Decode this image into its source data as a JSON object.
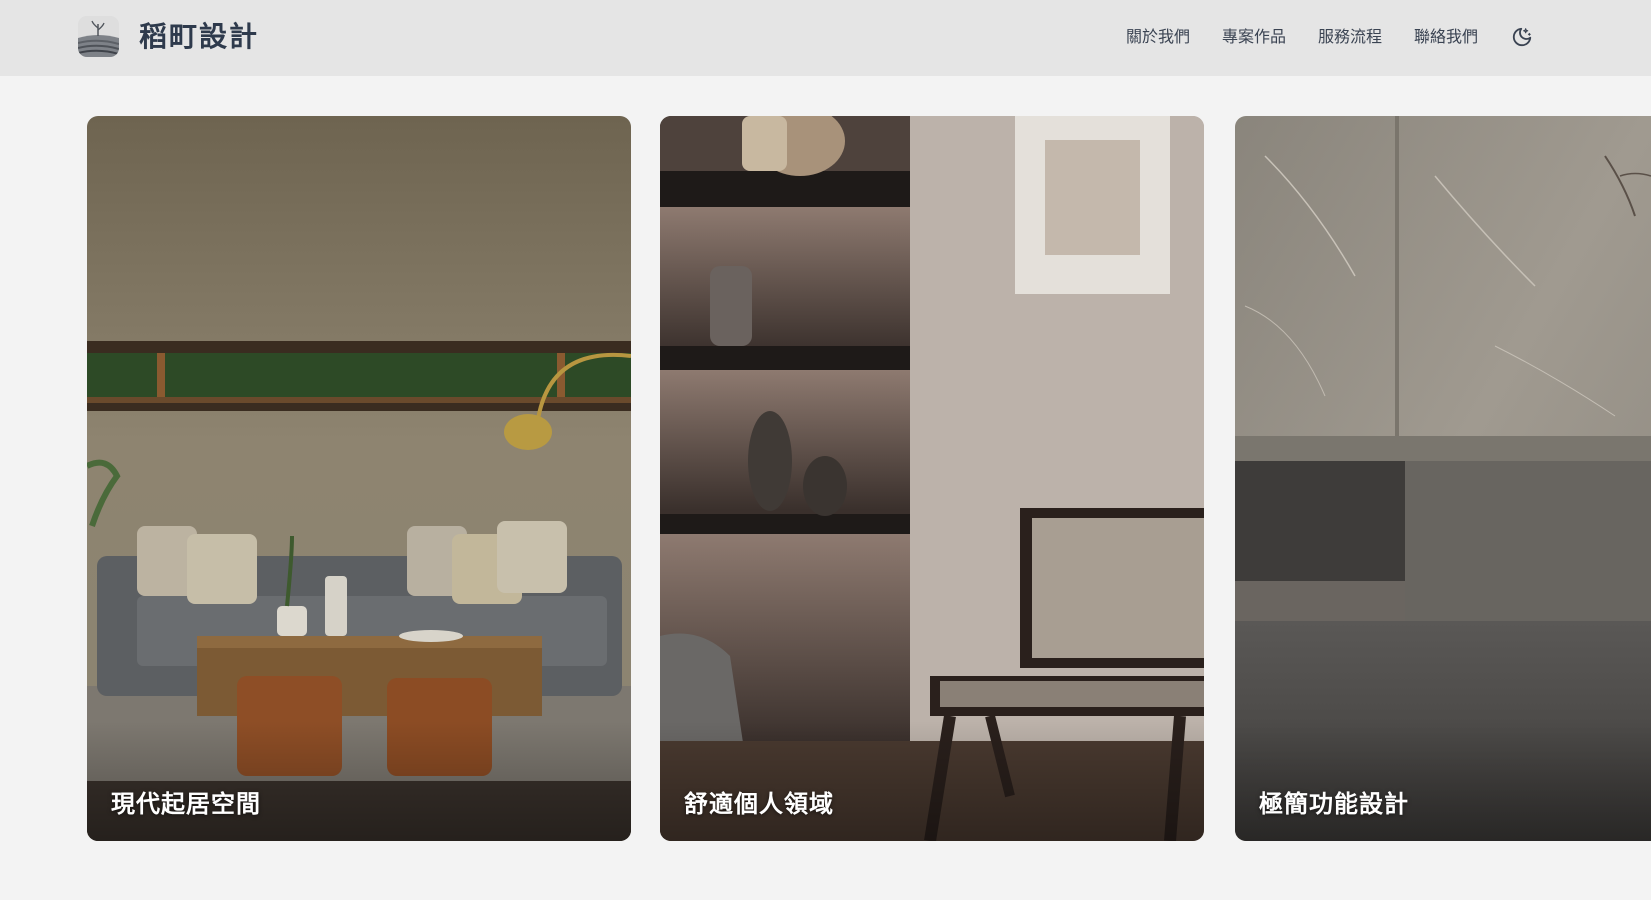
{
  "header": {
    "brand": "稻町設計",
    "logo_icon": "field-landscape-icon"
  },
  "nav": {
    "items": [
      {
        "label": "關於我們"
      },
      {
        "label": "專案作品"
      },
      {
        "label": "服務流程"
      },
      {
        "label": "聯絡我們"
      }
    ],
    "theme_toggle_icon": "moon-icon"
  },
  "projects": [
    {
      "title": "現代起居空間"
    },
    {
      "title": "舒適個人領域"
    },
    {
      "title": "極簡功能設計"
    }
  ],
  "colors": {
    "header_bg": "#e5e5e5",
    "page_bg": "#f3f3f3",
    "brand_text": "#2e3a4c",
    "nav_text": "#3a4352",
    "card_title": "#ffffff"
  }
}
